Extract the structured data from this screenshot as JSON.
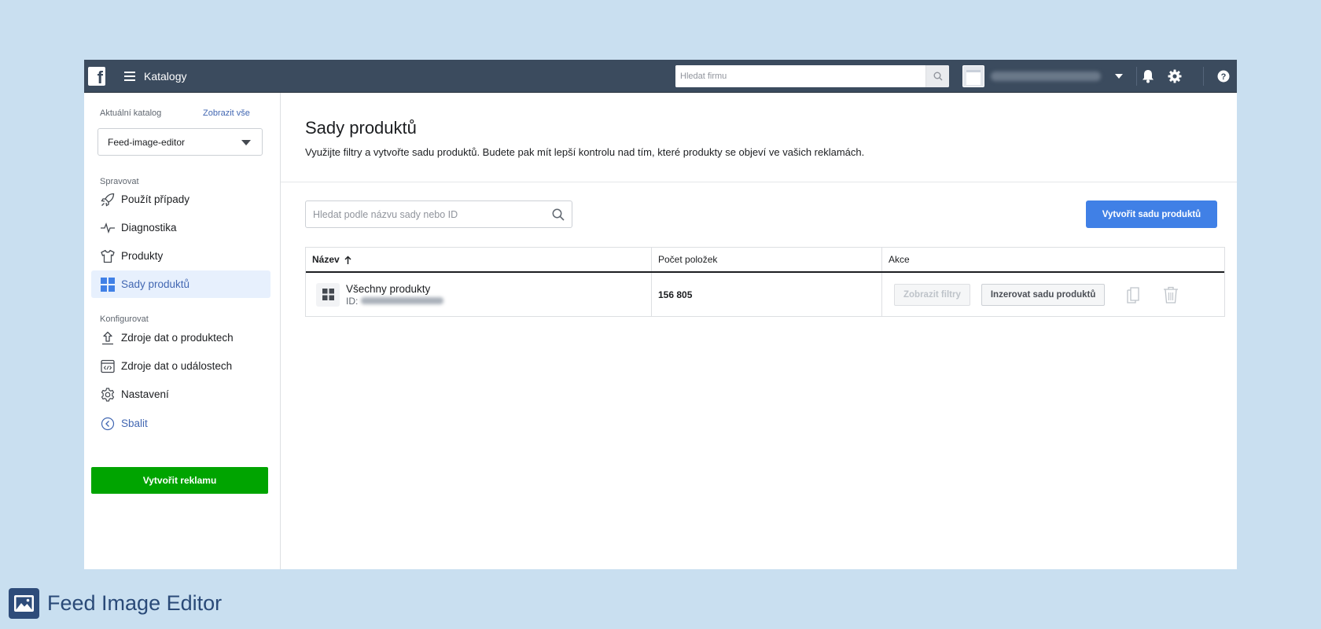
{
  "topbar": {
    "title": "Katalogy",
    "search_placeholder": "Hledat firmu"
  },
  "sidebar": {
    "catalog_label": "Aktuální katalog",
    "show_all": "Zobrazit vše",
    "catalog_value": "Feed-image-editor",
    "manage_label": "Spravovat",
    "manage_items": [
      {
        "label": "Použít případy",
        "icon": "rocket-icon"
      },
      {
        "label": "Diagnostika",
        "icon": "pulse-icon"
      },
      {
        "label": "Produkty",
        "icon": "tshirt-icon"
      },
      {
        "label": "Sady produktů",
        "icon": "grid-icon"
      }
    ],
    "configure_label": "Konfigurovat",
    "configure_items": [
      {
        "label": "Zdroje dat o produktech",
        "icon": "upload-icon"
      },
      {
        "label": "Zdroje dat o událostech",
        "icon": "code-window-icon"
      },
      {
        "label": "Nastavení",
        "icon": "gear-icon"
      }
    ],
    "collapse": "Sbalit",
    "create_ad": "Vytvořit reklamu"
  },
  "main": {
    "title": "Sady produktů",
    "description": "Využijte filtry a vytvořte sadu produktů. Budete pak mít lepší kontrolu nad tím, které produkty se objeví ve vašich reklamách.",
    "search_placeholder": "Hledat podle názvu sady nebo ID",
    "create_set": "Vytvořit sadu produktů",
    "table": {
      "headers": {
        "name": "Název",
        "count": "Počet položek",
        "actions": "Akce"
      },
      "rows": [
        {
          "name": "Všechny produkty",
          "id_label": "ID:",
          "count": "156 805",
          "view_filters": "Zobrazit filtry",
          "advertise": "Inzerovat sadu produktů"
        }
      ]
    }
  },
  "brand": {
    "name": "Feed Image Editor"
  },
  "colors": {
    "topbar": "#3b4b5e",
    "accent_blue": "#4080e6",
    "create_ad_green": "#00a400",
    "page_bg": "#c9dff0"
  }
}
